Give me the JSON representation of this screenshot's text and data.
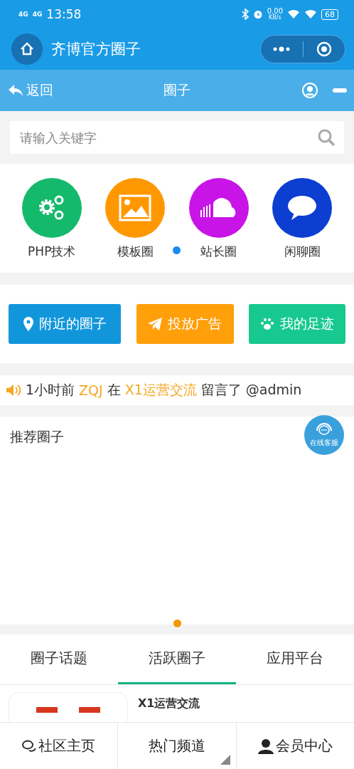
{
  "status_bar": {
    "network_1": "4G",
    "network_2": "4G",
    "time": "13:58",
    "speed": "0.00",
    "speed_unit": "KB/s",
    "battery": "68"
  },
  "app_bar": {
    "title": "齐博官方圈子"
  },
  "nav_bar": {
    "back": "返回",
    "title": "圈子"
  },
  "search": {
    "placeholder": "请输入关键字"
  },
  "categories": [
    {
      "label": "PHP技术",
      "color": "#14b96b"
    },
    {
      "label": "模板圈",
      "color": "#ff9800"
    },
    {
      "label": "站长圈",
      "color": "#c814e6"
    },
    {
      "label": "闲聊圈",
      "color": "#0c3fd1"
    }
  ],
  "category_pager": [
    {
      "selected": true
    }
  ],
  "actions": [
    {
      "label": "附近的圈子",
      "color": "#1296db"
    },
    {
      "label": "投放广告",
      "color": "#ff9f0a"
    },
    {
      "label": "我的足迹",
      "color": "#17c98f"
    }
  ],
  "notice": [
    {
      "text": "1小时前",
      "highlight": false
    },
    {
      "text": "ZQJ",
      "highlight": true
    },
    {
      "text": "在",
      "highlight": false
    },
    {
      "text": "X1运营交流",
      "highlight": true
    },
    {
      "text": "留言了 @admin",
      "highlight": false
    }
  ],
  "recommend": {
    "title": "推荐圈子",
    "pager": [
      {
        "selected": true
      }
    ]
  },
  "service_badge": "在线客服",
  "tabs": [
    {
      "label": "圈子话题",
      "selected": false
    },
    {
      "label": "活跃圈子",
      "selected": true
    },
    {
      "label": "应用平台",
      "selected": false
    }
  ],
  "card": {
    "title": "X1运营交流"
  },
  "bottom_nav": [
    {
      "label": "社区主页",
      "submenu": false
    },
    {
      "label": "热门频道",
      "submenu": true
    },
    {
      "label": "会员中心",
      "submenu": false
    }
  ]
}
